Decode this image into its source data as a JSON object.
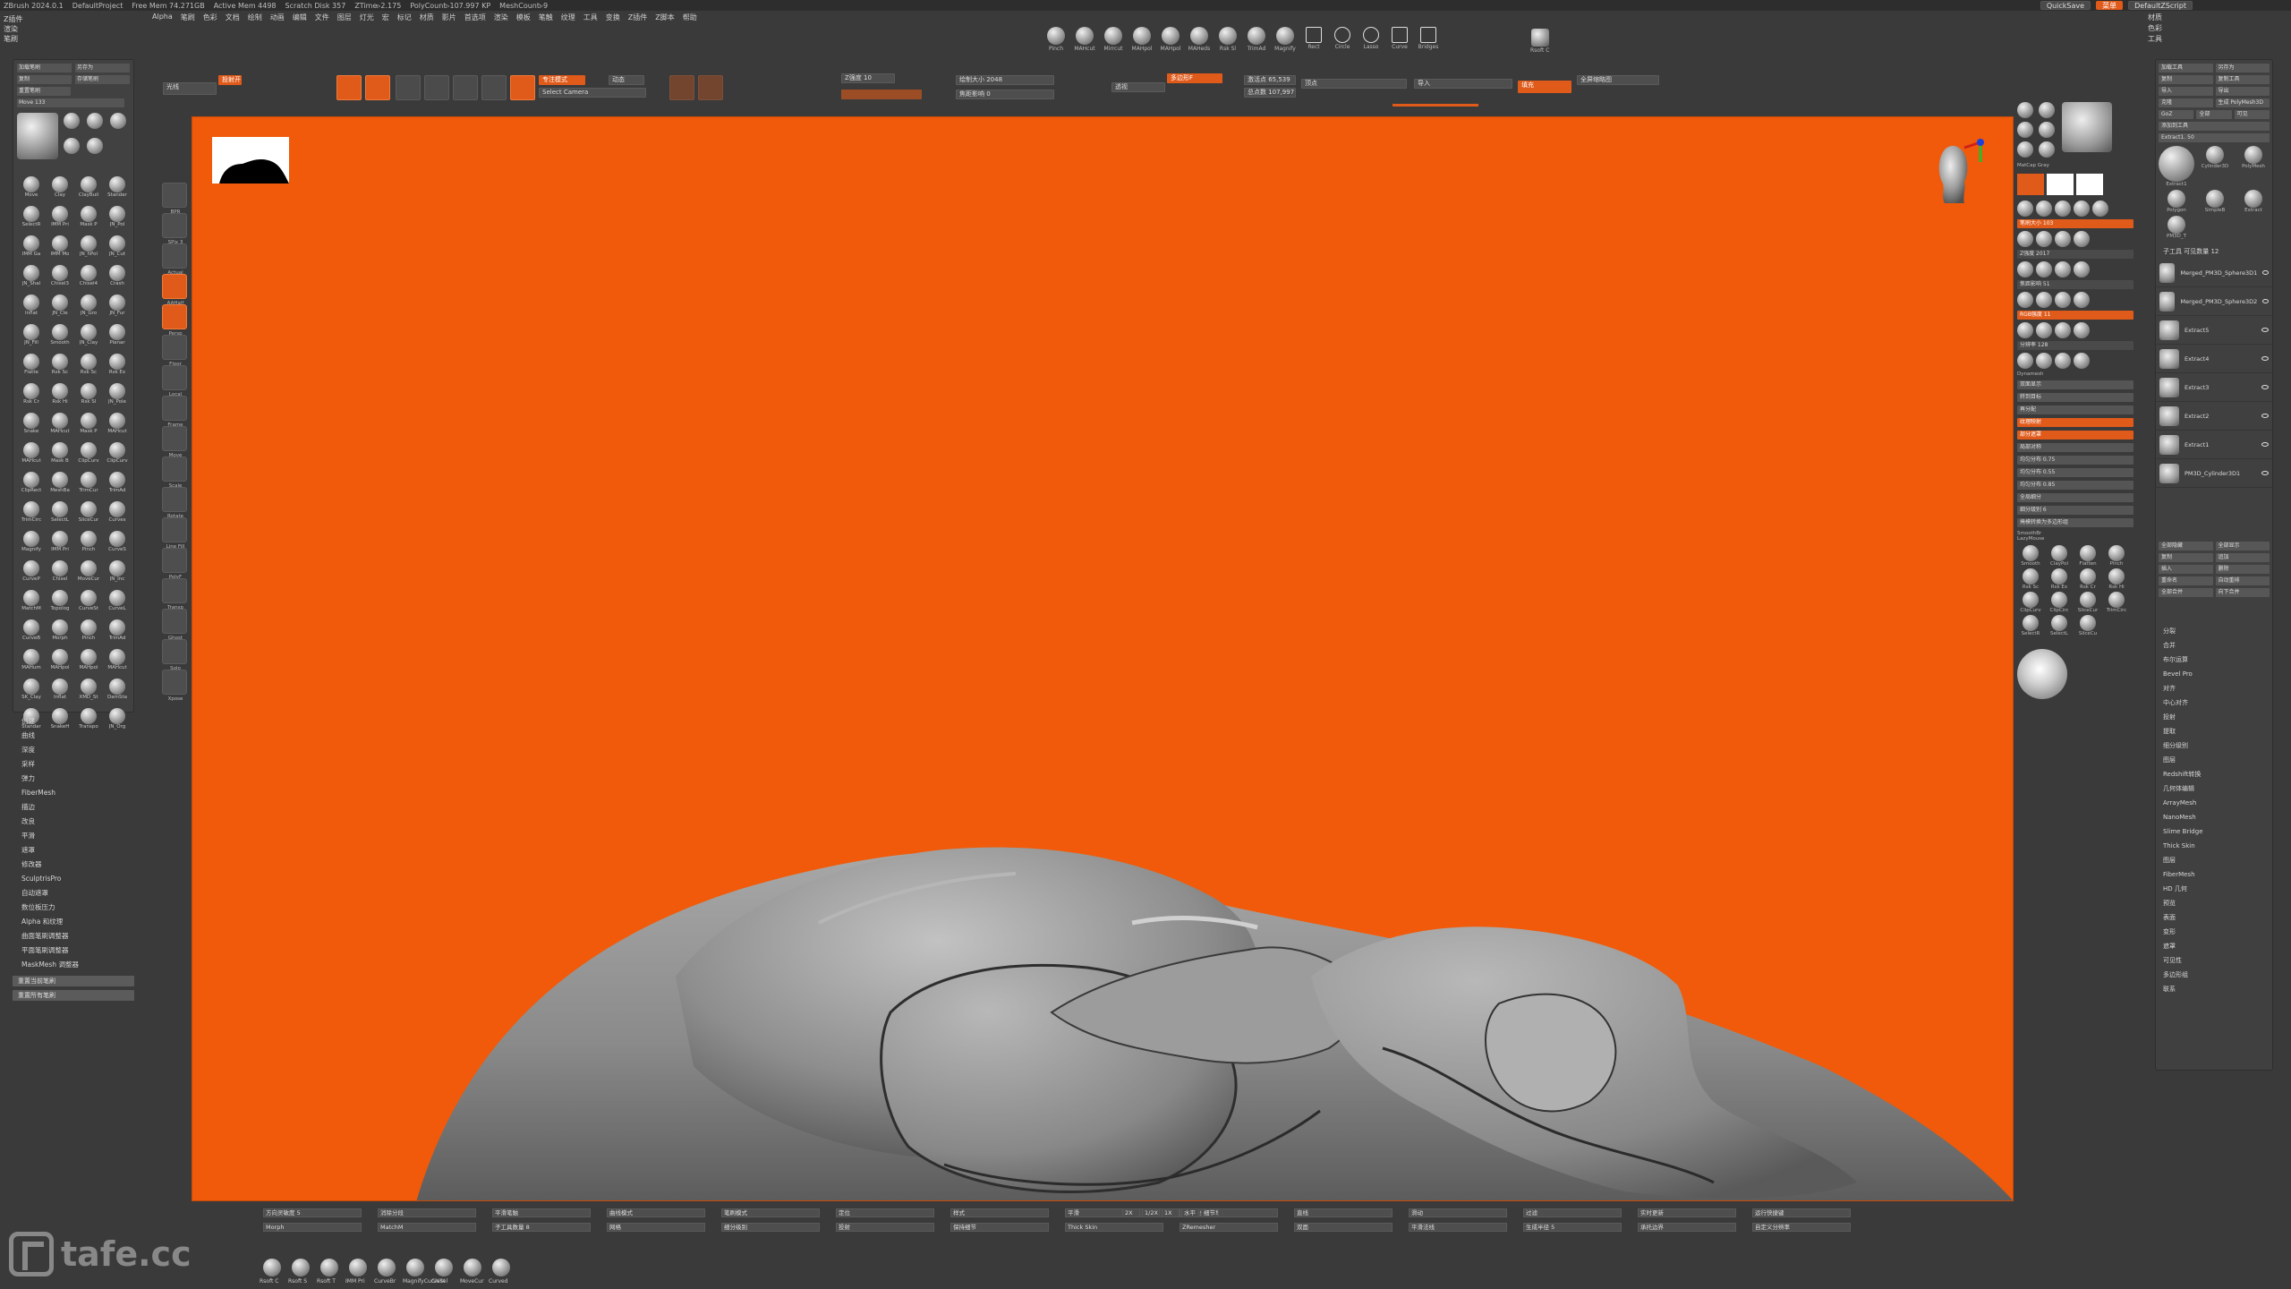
{
  "titlebar": {
    "app": "ZBrush 2024.0.1",
    "items": [
      "DefaultProject",
      "Free Mem 74.271GB",
      "Active Mem 4498",
      "Scratch Disk 357",
      "ZTime▹2.175",
      "PolyCount▹107.997 KP",
      "MeshCount▹9"
    ]
  },
  "top_right": {
    "quicksave": "QuickSave",
    "menus_button": "菜单",
    "script": "DefaultZScript"
  },
  "menubar": [
    "Alpha",
    "笔刷",
    "色彩",
    "文档",
    "绘制",
    "动画",
    "编辑",
    "文件",
    "图层",
    "灯光",
    "宏",
    "标记",
    "材质",
    "影片",
    "首选项",
    "渲染",
    "模板",
    "笔触",
    "纹理",
    "工具",
    "变换",
    "Z插件",
    "Z脚本",
    "帮助"
  ],
  "left_tabs": [
    "Z插件",
    "渲染",
    "笔刷"
  ],
  "shelf": [
    {
      "label": "Pinch",
      "kind": "sphere"
    },
    {
      "label": "MAHcut",
      "kind": "sphere"
    },
    {
      "label": "Mirrcut",
      "kind": "sphere"
    },
    {
      "label": "MAHpol",
      "kind": "sphere"
    },
    {
      "label": "MAHpol",
      "kind": "sphere"
    },
    {
      "label": "MAHeds",
      "kind": "sphere"
    },
    {
      "label": "Rsk Sl",
      "kind": "sphere"
    },
    {
      "label": "TrimAd",
      "kind": "sphere"
    },
    {
      "label": "Magnify",
      "kind": "sphere"
    },
    {
      "label": "Rect",
      "kind": "rect"
    },
    {
      "label": "Circle",
      "kind": "circle"
    },
    {
      "label": "Lasso",
      "kind": "lasso"
    },
    {
      "label": "Curve",
      "kind": "curve"
    },
    {
      "label": "Bridges",
      "kind": "rect"
    }
  ],
  "shelf_extra": "Rsoft C",
  "toolbar": {
    "items": [
      "光线",
      "投射开关",
      "当前笔触",
      "编辑",
      "绘制",
      "移动",
      "缩放",
      "旋转",
      "Mrgb",
      "Rgb",
      "M",
      "Zadd",
      "Zsub",
      "Zcut"
    ],
    "camera_label": "专注模式",
    "select_camera": "Select Camera",
    "dynamic": "动态",
    "z_intensity": "Z强度 10",
    "draw_size": "绘制大小 2048",
    "focal": "焦距影响 0",
    "persp": "透视",
    "multi": "多边形F",
    "active_points": "激活点 65,539",
    "total_points": "总点数 107,997",
    "vertex": "顶点",
    "guide": "导入",
    "fill": "填充",
    "thumbnails": "全屏缩略图"
  },
  "left_panel": {
    "rows": [
      [
        "加载笔刷",
        "另存为"
      ],
      [
        "复制",
        "存储笔刷"
      ],
      [
        "重置笔刷",
        ""
      ]
    ],
    "size_label": "Move 133"
  },
  "brushes": [
    "Move",
    "Clay",
    "ClayBuil",
    "Standar",
    "SelectR",
    "IMM Pri",
    "Mask P",
    "JN_Pol",
    "IMM Ga",
    "IMM Mo",
    "JN_hPol",
    "JN_Cut",
    "JN_Shal",
    "Chisel3",
    "Chisel4",
    "Crash",
    "Inflat",
    "JN_Cle",
    "JN_Gro",
    "JN_Fur",
    "JN_Fill",
    "Smooth",
    "JN_Clay",
    "Planar",
    "Flatte",
    "Rsk Sc",
    "Rsk Sc",
    "Rsk Ex",
    "Rsk Cr",
    "Rsk Hi",
    "Rsk Sl",
    "JN_Pole",
    "Snake",
    "MAHcut",
    "Mask P",
    "MAHcut",
    "MAHcut",
    "Mask B",
    "ClipCurv",
    "ClipCurv",
    "ClipRect",
    "MeshBa",
    "TrimCur",
    "TrimAd",
    "TrimCirc",
    "SelectL",
    "SliceCur",
    "Curves",
    "Magnify",
    "IMM Pri",
    "Pinch",
    "CurveS",
    "CurveP",
    "Chisel",
    "MoveCur",
    "JN_Inc",
    "MatchM",
    "Topolog",
    "CurveSt",
    "CurveL",
    "CurveB",
    "Morph",
    "Pinch",
    "TrimAd",
    "MAHum",
    "MAHpol",
    "MAHpol",
    "MAHcut",
    "SK_Clay",
    "Inflat",
    "XMD_St",
    "DamSta",
    "Standar",
    "SnakeH",
    "Transpo",
    "JN_Org"
  ],
  "left_list": [
    "创建",
    "曲线",
    "深度",
    "采样",
    "弹力",
    "FiberMesh",
    "描边",
    "改良",
    "平滑",
    "遮罩",
    "修改器",
    "SculptrisPro",
    "自动遮罩",
    "数位板压力",
    "Alpha 和纹理",
    "曲面笔刷调整器",
    "平面笔刷调整器",
    "MaskMesh 调整器"
  ],
  "left_list_buttons": [
    "重置当前笔刷",
    "重置所有笔刷"
  ],
  "left_tools": [
    "BPR",
    "SPix 3",
    "Actual",
    "AAHalf",
    "Persp",
    "Floor",
    "Local",
    "Frame",
    "Move",
    "Scale",
    "Rotate",
    "Line Fill",
    "PolyF",
    "Transp",
    "Ghost",
    "Solo",
    "Xpose"
  ],
  "right_a": {
    "material": "MatCap Gray",
    "brush_size": "笔刷大小 103",
    "z_intensity": "Z强度 2017",
    "focal": "焦距影响 51",
    "rgb": "RGB强度 11",
    "dynamesh": "Dynamesh",
    "resolution": "分辨率 128",
    "smooth": "SmoothBr",
    "lazy": "LazyMouse",
    "bottom_labels": [
      "Smooth",
      "ClayPol",
      "Flatten",
      "Pinch",
      "Rsk Sc",
      "Rsk Ex",
      "Rsk Cr",
      "Rsk Hi",
      "ClipCurv",
      "ClipCirc",
      "SliceCur",
      "TrimCirc",
      "SelectR",
      "SelectL",
      "SliceCu"
    ],
    "mid_bars": [
      "双面显示",
      "转到目标",
      "再分配",
      "纹理映射",
      "部分遮罩",
      "局部对称",
      "均匀分布 0.75",
      "均匀分布 0.55",
      "均匀分布 0.85",
      "全局细分",
      "细分级别 6",
      "掩模转换为多边形组"
    ]
  },
  "right_b": {
    "rows": [
      [
        "加载工具",
        "另存为"
      ],
      [
        "复制",
        "复制工具"
      ],
      [
        "导入",
        "导出"
      ],
      [
        "克隆",
        "生成 PolyMesh3D"
      ],
      [
        "GoZ",
        "全部",
        "可见"
      ],
      [
        "添加到工具"
      ]
    ],
    "extract_label": "Extract1. 50",
    "tool_thumbs": [
      "Extract1",
      "Cylinder3D",
      "PolyMesh",
      "Polygon",
      "SimpleB",
      "Extract",
      "PM3D_T"
    ],
    "subtool_header": "子工具 可见数量 12",
    "subtools": [
      "Merged_PM3D_Sphere3D1",
      "Merged_PM3D_Sphere3D2",
      "Extract5",
      "Extract4",
      "Extract3",
      "Extract2",
      "Extract1",
      "PM3D_Cylinder3D1"
    ],
    "buttons": [
      [
        "全部隐藏",
        "全部显示"
      ],
      [
        "复制",
        "追加"
      ],
      [
        "插入",
        "删除"
      ],
      [
        "重命名",
        "自动重排"
      ],
      [
        "全部合并",
        "向下合并"
      ]
    ],
    "list": [
      "分裂",
      "合并",
      "布尔运算",
      "Bevel Pro",
      "对齐",
      "中心对齐",
      "投射",
      "提取",
      "细分级别",
      "图层",
      "Redshift转换",
      "几何体编辑",
      "ArrayMesh",
      "NanoMesh",
      "Slime Bridge",
      "Thick Skin",
      "图层",
      "FiberMesh",
      "HD 几何",
      "预览",
      "表面",
      "变形",
      "遮罩",
      "可见性",
      "多边形组",
      "联系"
    ]
  },
  "right_strip": [
    "材质",
    "色彩",
    "工具"
  ],
  "bottom": {
    "fields": [
      "方向灵敏度 5",
      "消除分段",
      "平滑笔触",
      "曲线模式",
      "笔刷模式",
      "定位",
      "样式",
      "平滑",
      "合并线条",
      "直线",
      "滑动",
      "过滤",
      "实时更新",
      "运行快捷键",
      "Morph",
      "MatchM",
      "子工具数量 8",
      "网格",
      "细分级别",
      "投射",
      "保持细节",
      "Thick Skin",
      "ZRemesher",
      "双面",
      "平滑法线",
      "生成半径 5",
      "承托边界",
      "自定义分辨率"
    ],
    "tools_row": [
      "Rsoft C",
      "Rsoft S",
      "Rsoft T",
      "IMM Pri",
      "CurveBr",
      "MagnifyCurveSt",
      "Chisel",
      "MoveCur",
      "Curved"
    ],
    "page_buttons": [
      "2X",
      "1/2X",
      "1X",
      "水平",
      "细节增强"
    ]
  },
  "watermark": "tafe.cc",
  "colors": {
    "accent": "#e05a1a",
    "canvas": "#f05a0a",
    "panel": "#414141",
    "background": "#3a3a3a"
  }
}
